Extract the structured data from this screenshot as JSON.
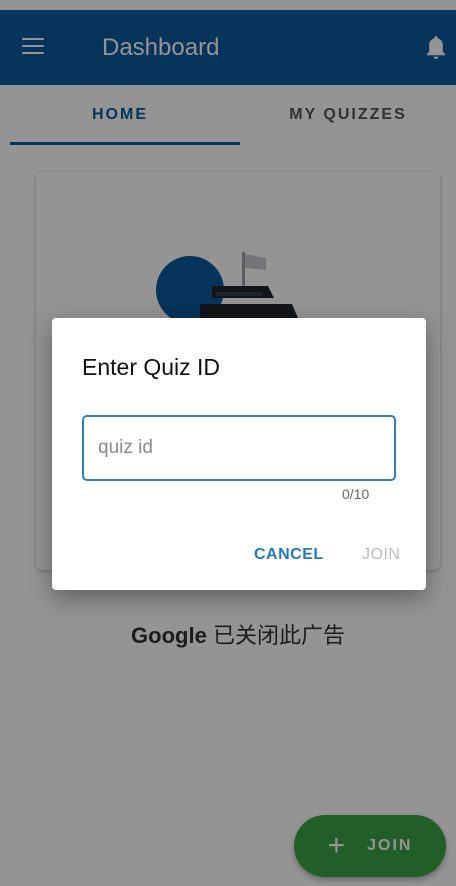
{
  "app_bar": {
    "title": "Dashboard",
    "menu_icon": "menu-icon",
    "notification_icon": "bell-icon",
    "color": "#0d5a9c"
  },
  "tabs": [
    {
      "label": "HOME",
      "selected": true
    },
    {
      "label": "MY QUIZZES",
      "selected": false
    }
  ],
  "ad_notice": {
    "brand": "Google",
    "text": "已关闭此广告"
  },
  "fab": {
    "icon": "plus-icon",
    "label": "JOIN",
    "color": "#3aa246"
  },
  "dialog": {
    "title": "Enter Quiz ID",
    "input": {
      "value": "",
      "placeholder": "quiz id"
    },
    "counter": "0/10",
    "cancel_label": "CANCEL",
    "join_label": "JOIN",
    "join_enabled": false
  }
}
